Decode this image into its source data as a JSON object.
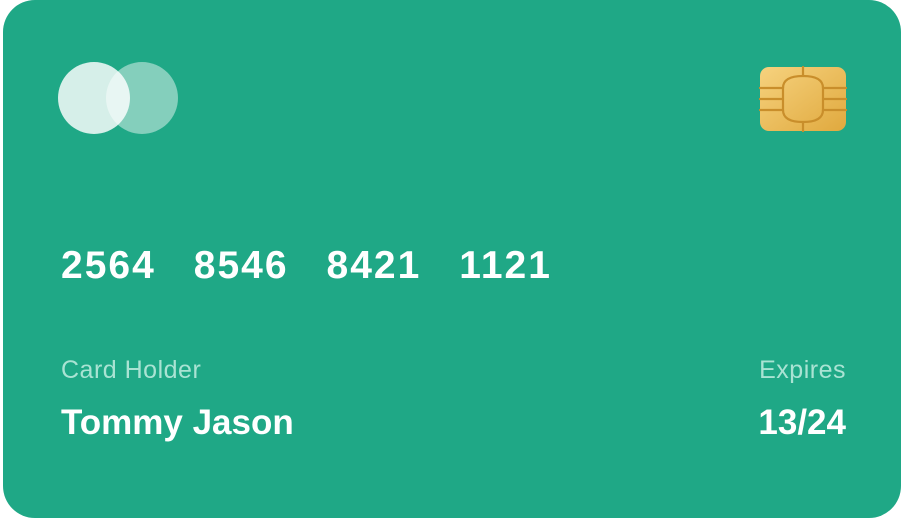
{
  "card": {
    "number_groups": [
      "2564",
      "8546",
      "8421",
      "1121"
    ],
    "holder_label": "Card Holder",
    "holder_name": "Tommy Jason",
    "expires_label": "Expires",
    "expires_value": "13/24"
  },
  "icons": {
    "brand_logo": "two-overlapping-circles-logo-icon",
    "chip": "emv-chip-icon"
  },
  "colors": {
    "card_background": "#1fa886",
    "label_text": "#a9e3d3",
    "primary_text": "#ffffff",
    "chip_gold_light": "#f6d27e",
    "chip_gold_dark": "#e0a93e",
    "chip_line": "#c98e2b"
  }
}
